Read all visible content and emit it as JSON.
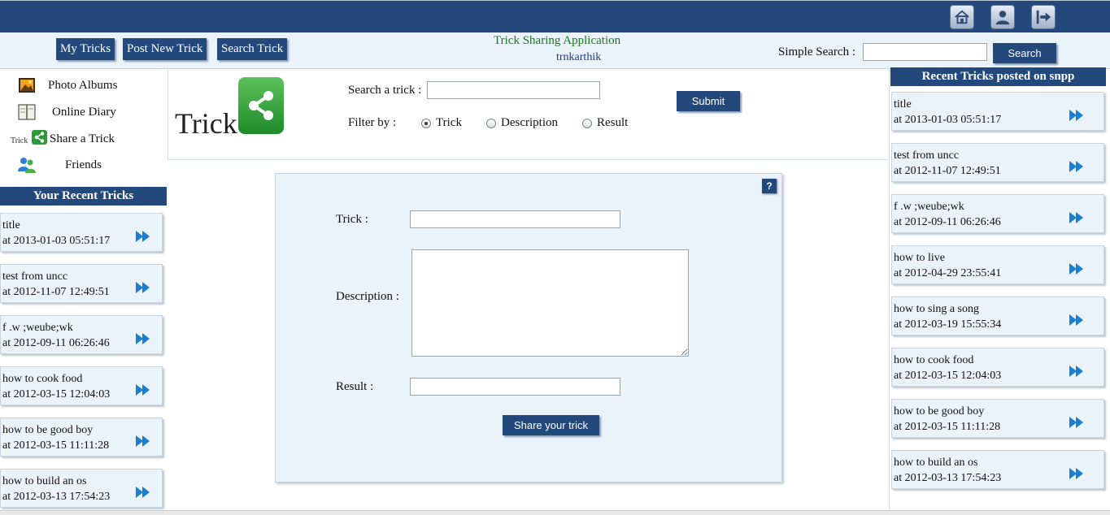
{
  "header": {
    "icons": [
      "home-icon",
      "user-icon",
      "logout-icon"
    ]
  },
  "nav": {
    "buttons": [
      "My Tricks",
      "Post New Trick",
      "Search Trick"
    ],
    "app_title": "Trick Sharing Application",
    "username": "trnkarthik",
    "simple_search_label": "Simple Search :",
    "simple_search_value": "",
    "search_button": "Search"
  },
  "left_menu": {
    "items": [
      {
        "label": "Photo Albums",
        "icon": "photo-album-icon"
      },
      {
        "label": "Online Diary",
        "icon": "diary-icon"
      },
      {
        "label": "Share a Trick",
        "icon": "share-trick-icon",
        "icon_text": "Trick"
      },
      {
        "label": "Friends",
        "icon": "friends-icon"
      }
    ],
    "recent_header": "Your Recent Tricks",
    "recent": [
      {
        "title": "title",
        "time": "at 2013-01-03 05:51:17"
      },
      {
        "title": "test from uncc",
        "time": "at 2012-11-07 12:49:51"
      },
      {
        "title": "f .w ;weube;wk",
        "time": "at 2012-09-11 06:26:46"
      },
      {
        "title": "how to cook food",
        "time": "at 2012-03-15 12:04:03"
      },
      {
        "title": "how to be good boy",
        "time": "at 2012-03-15 11:11:28"
      },
      {
        "title": "how to build an os",
        "time": "at 2012-03-13 17:54:23"
      }
    ]
  },
  "search_area": {
    "logo_text": "Trick",
    "search_label": "Search a trick :",
    "search_value": "",
    "submit_button": "Submit",
    "filter_label": "Filter by :",
    "filter_options": [
      {
        "label": "Trick",
        "selected": true
      },
      {
        "label": "Description",
        "selected": false
      },
      {
        "label": "Result",
        "selected": false
      }
    ]
  },
  "form": {
    "help_button": "?",
    "trick_label": "Trick :",
    "trick_value": "",
    "description_label": "Description :",
    "description_value": "",
    "result_label": "Result :",
    "result_value": "",
    "share_button": "Share your trick"
  },
  "right_panel": {
    "header": "Recent Tricks posted on snpp",
    "recent": [
      {
        "title": "title",
        "time": "at 2013-01-03 05:51:17"
      },
      {
        "title": "test from uncc",
        "time": "at 2012-11-07 12:49:51"
      },
      {
        "title": "f .w ;weube;wk",
        "time": "at 2012-09-11 06:26:46"
      },
      {
        "title": "how to live",
        "time": "at 2012-04-29 23:55:41"
      },
      {
        "title": "how to sing a song",
        "time": "at 2012-03-19 15:55:34"
      },
      {
        "title": "how to cook food",
        "time": "at 2012-03-15 12:04:03"
      },
      {
        "title": "how to be good boy",
        "time": "at 2012-03-15 11:11:28"
      },
      {
        "title": "how to build an os",
        "time": "at 2012-03-13 17:54:23"
      }
    ]
  },
  "colors": {
    "brand_blue": "#23497c",
    "panel_bg": "#eaf2fa",
    "title_green": "#1a7a1a",
    "arrow_blue": "#1a7fd0"
  }
}
